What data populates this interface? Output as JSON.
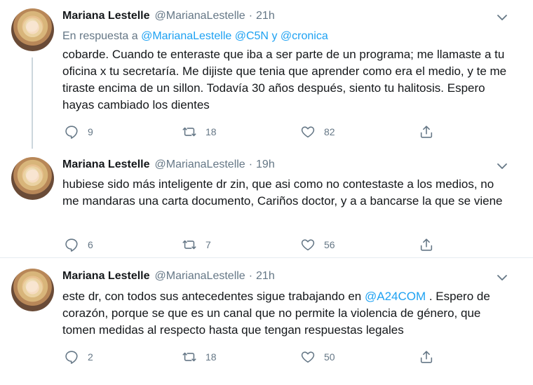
{
  "tweets": [
    {
      "name": "Mariana Lestelle",
      "handle": "@MarianaLestelle",
      "separator": "·",
      "time": "21h",
      "reply_prefix": "En respuesta a",
      "reply_mentions": [
        "@MarianaLestelle",
        "@C5N",
        "y",
        "@cronica"
      ],
      "text": "cobarde. Cuando te enteraste que iba a ser parte de un programa; me llamaste a tu oficina x  tu secretaría. Me dijiste que tenia que aprender como era el medio, y te me tiraste encima de un sillon. Todavía 30 años después, siento tu halitosis. Espero hayas cambiado los dientes",
      "replies": "9",
      "retweets": "18",
      "likes": "82"
    },
    {
      "name": "Mariana Lestelle",
      "handle": "@MarianaLestelle",
      "separator": "·",
      "time": "19h",
      "text": "hubiese sido más inteligente dr zin, que asi como no contestaste a los medios, no me mandaras una carta documento, Cariños doctor, y a a bancarse la que se viene",
      "replies": "6",
      "retweets": "7",
      "likes": "56"
    },
    {
      "name": "Mariana Lestelle",
      "handle": "@MarianaLestelle",
      "separator": "·",
      "time": "21h",
      "text_before": "este dr, con todos sus antecedentes sigue trabajando en ",
      "mention": "@A24COM",
      "text_after": " . Espero de corazón, porque se que es un canal que no permite la violencia de género, que tomen medidas al respecto hasta que tengan respuestas legales",
      "replies": "2",
      "retweets": "18",
      "likes": "50"
    }
  ],
  "icons": {
    "reply": "reply-icon",
    "retweet": "retweet-icon",
    "like": "heart-icon",
    "share": "share-icon",
    "menu": "chevron-down-icon"
  },
  "colors": {
    "link": "#1da1f2",
    "muted": "#657786",
    "text": "#14171a",
    "divider": "#e6ecf0"
  }
}
